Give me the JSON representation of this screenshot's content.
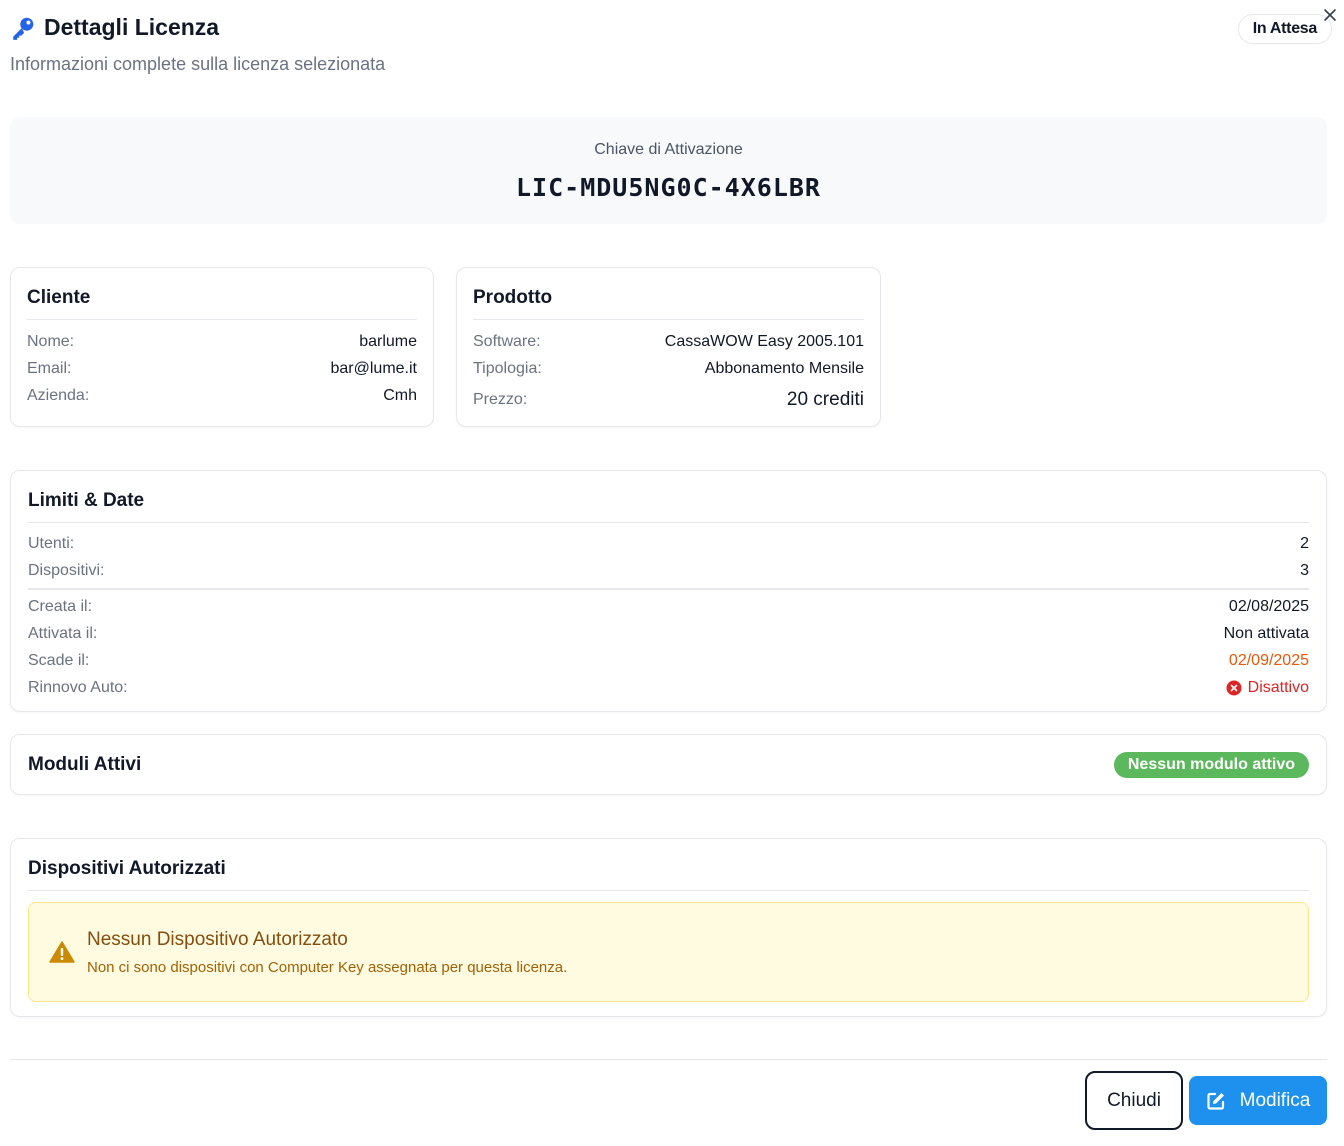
{
  "header": {
    "title": "Dettagli Licenza",
    "subtitle": "Informazioni complete sulla licenza selezionata",
    "status": "In Attesa",
    "icon": "key-icon"
  },
  "activation": {
    "label": "Chiave di Attivazione",
    "key": "LIC-MDU5NG0C-4X6LBR"
  },
  "cliente": {
    "title": "Cliente",
    "rows": [
      {
        "label": "Nome:",
        "value": "barlume"
      },
      {
        "label": "Email:",
        "value": "bar@lume.it"
      },
      {
        "label": "Azienda:",
        "value": "Cmh"
      }
    ]
  },
  "prodotto": {
    "title": "Prodotto",
    "rows": [
      {
        "label": "Software:",
        "value": "CassaWOW Easy 2005.101"
      },
      {
        "label": "Tipologia:",
        "value": "Abbonamento Mensile"
      },
      {
        "label": "Prezzo:",
        "value": "20 crediti"
      }
    ]
  },
  "limiti": {
    "title": "Limiti & Date",
    "limits": [
      {
        "label": "Utenti:",
        "value": "2"
      },
      {
        "label": "Dispositivi:",
        "value": "3"
      }
    ],
    "dates": [
      {
        "label": "Creata il:",
        "value": "02/08/2025"
      },
      {
        "label": "Attivata il:",
        "value": "Non attivata"
      },
      {
        "label": "Scade il:",
        "value": "02/09/2025"
      },
      {
        "label": "Rinnovo Auto:",
        "value": "Disattivo"
      }
    ]
  },
  "moduli": {
    "title": "Moduli Attivi",
    "badge": "Nessun modulo attivo"
  },
  "dispositivi": {
    "title": "Dispositivi Autorizzati",
    "warning_title": "Nessun Dispositivo Autorizzato",
    "warning_text": "Non ci sono dispositivi con Computer Key assegnata per questa licenza."
  },
  "footer": {
    "close_label": "Chiudi",
    "edit_label": "Modifica"
  },
  "colors": {
    "accent": "#1e90ee",
    "expiry": "#ea580c",
    "inactive": "#dc2626",
    "badge_green": "#5cb85c",
    "warning_bg": "#fffbe0"
  }
}
